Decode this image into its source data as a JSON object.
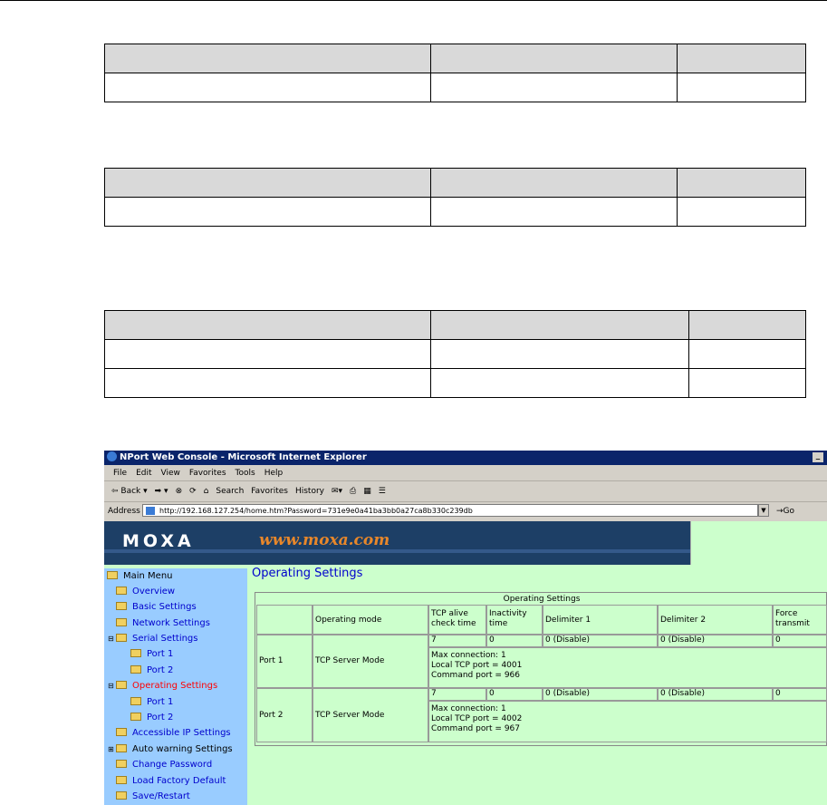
{
  "doc": {
    "tables": [
      {
        "rows": [
          [
            "",
            "",
            ""
          ],
          [
            "",
            "",
            ""
          ]
        ]
      },
      {
        "rows": [
          [
            "",
            "",
            ""
          ],
          [
            "",
            "",
            ""
          ]
        ]
      },
      {
        "rows": [
          [
            "",
            "",
            ""
          ],
          [
            "",
            "",
            ""
          ],
          [
            "",
            "",
            ""
          ]
        ]
      }
    ]
  },
  "browser": {
    "title": "NPort Web Console - Microsoft Internet Explorer",
    "menu": [
      "File",
      "Edit",
      "View",
      "Favorites",
      "Tools",
      "Help"
    ],
    "toolbar": [
      "⇦ Back ▾",
      "➡ ▾",
      "⊗",
      "⟳",
      "⌂",
      "Search",
      "Favorites",
      "History",
      "✉▾",
      "⎙",
      "▦",
      "☰"
    ],
    "address_label": "Address",
    "address": "http://192.168.127.254/home.htm?Password=731e9e0a41ba3bb0a27ca8b330c239db",
    "go": "Go"
  },
  "banner": {
    "logo": "MOXA",
    "url": "www.moxa.com"
  },
  "nav": {
    "main": "Main Menu",
    "overview": "Overview",
    "basic": "Basic Settings",
    "network": "Network Settings",
    "serial": "Serial Settings",
    "serial_port1": "Port 1",
    "serial_port2": "Port 2",
    "operating": "Operating Settings",
    "op_port1": "Port 1",
    "op_port2": "Port 2",
    "accessible": "Accessible IP Settings",
    "autowarn": "Auto warning Settings",
    "password": "Change Password",
    "factory": "Load Factory Default",
    "save": "Save/Restart"
  },
  "main": {
    "title": "Operating Settings",
    "caption": "Operating Settings",
    "headers": {
      "mode": "Operating mode",
      "tcp1": "TCP alive",
      "tcp2": "check time",
      "inact1": "Inactivity",
      "inact2": "time",
      "delim1": "Delimiter 1",
      "delim2": "Delimiter 2",
      "force1": "Force",
      "force2": "transmit"
    },
    "port1": {
      "name": "Port 1",
      "mode": "TCP Server Mode",
      "tcp": "7",
      "inact": "0",
      "delim1": "0 (Disable)",
      "delim2": "0 (Disable)",
      "force": "0",
      "info1": "Max connection: 1",
      "info2": "Local TCP port = 4001",
      "info3": "Command port = 966"
    },
    "port2": {
      "name": "Port 2",
      "mode": "TCP Server Mode",
      "tcp": "7",
      "inact": "0",
      "delim1": "0 (Disable)",
      "delim2": "0 (Disable)",
      "force": "0",
      "info1": "Max connection: 1",
      "info2": "Local TCP port = 4002",
      "info3": "Command port = 967"
    }
  },
  "colors": {
    "banner": "#1d3f66",
    "url": "#e8872a",
    "sidebar": "#99ccff",
    "content": "#ccffcc",
    "link": "#0000cc",
    "active": "#ff0000"
  }
}
